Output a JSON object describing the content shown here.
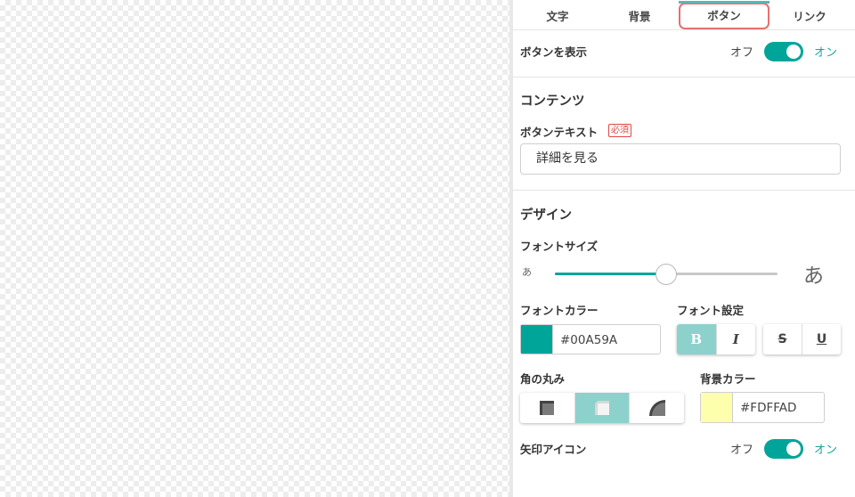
{
  "tabs": [
    {
      "label": "文字"
    },
    {
      "label": "背景"
    },
    {
      "label": "ボタン"
    },
    {
      "label": "リンク"
    }
  ],
  "show_button": {
    "label": "ボタンを表示",
    "off": "オフ",
    "on": "オン",
    "state": "on"
  },
  "contents": {
    "heading": "コンテンツ",
    "button_text_label": "ボタンテキスト",
    "required_badge": "必須",
    "button_text_value": "詳細を見る"
  },
  "design": {
    "heading": "デザイン",
    "font_size_label": "フォントサイズ",
    "slider_min_glyph": "あ",
    "slider_max_glyph": "あ",
    "font_size_level": 0.5,
    "font_color_label": "フォントカラー",
    "font_color_value": "#00A59A",
    "font_settings_label": "フォント設定",
    "bold_glyph": "B",
    "italic_glyph": "I",
    "strike_glyph": "S",
    "underline_glyph": "U",
    "corner_label": "角の丸み",
    "bg_color_label": "背景カラー",
    "bg_color_value": "#FDFFAD",
    "arrow_icon_label": "矢印アイコン",
    "arrow_off": "オフ",
    "arrow_on": "オン",
    "arrow_state": "on"
  },
  "colors": {
    "accent": "#00A59A",
    "active_tab_border": "#e86f6f",
    "required": "#e24848"
  }
}
